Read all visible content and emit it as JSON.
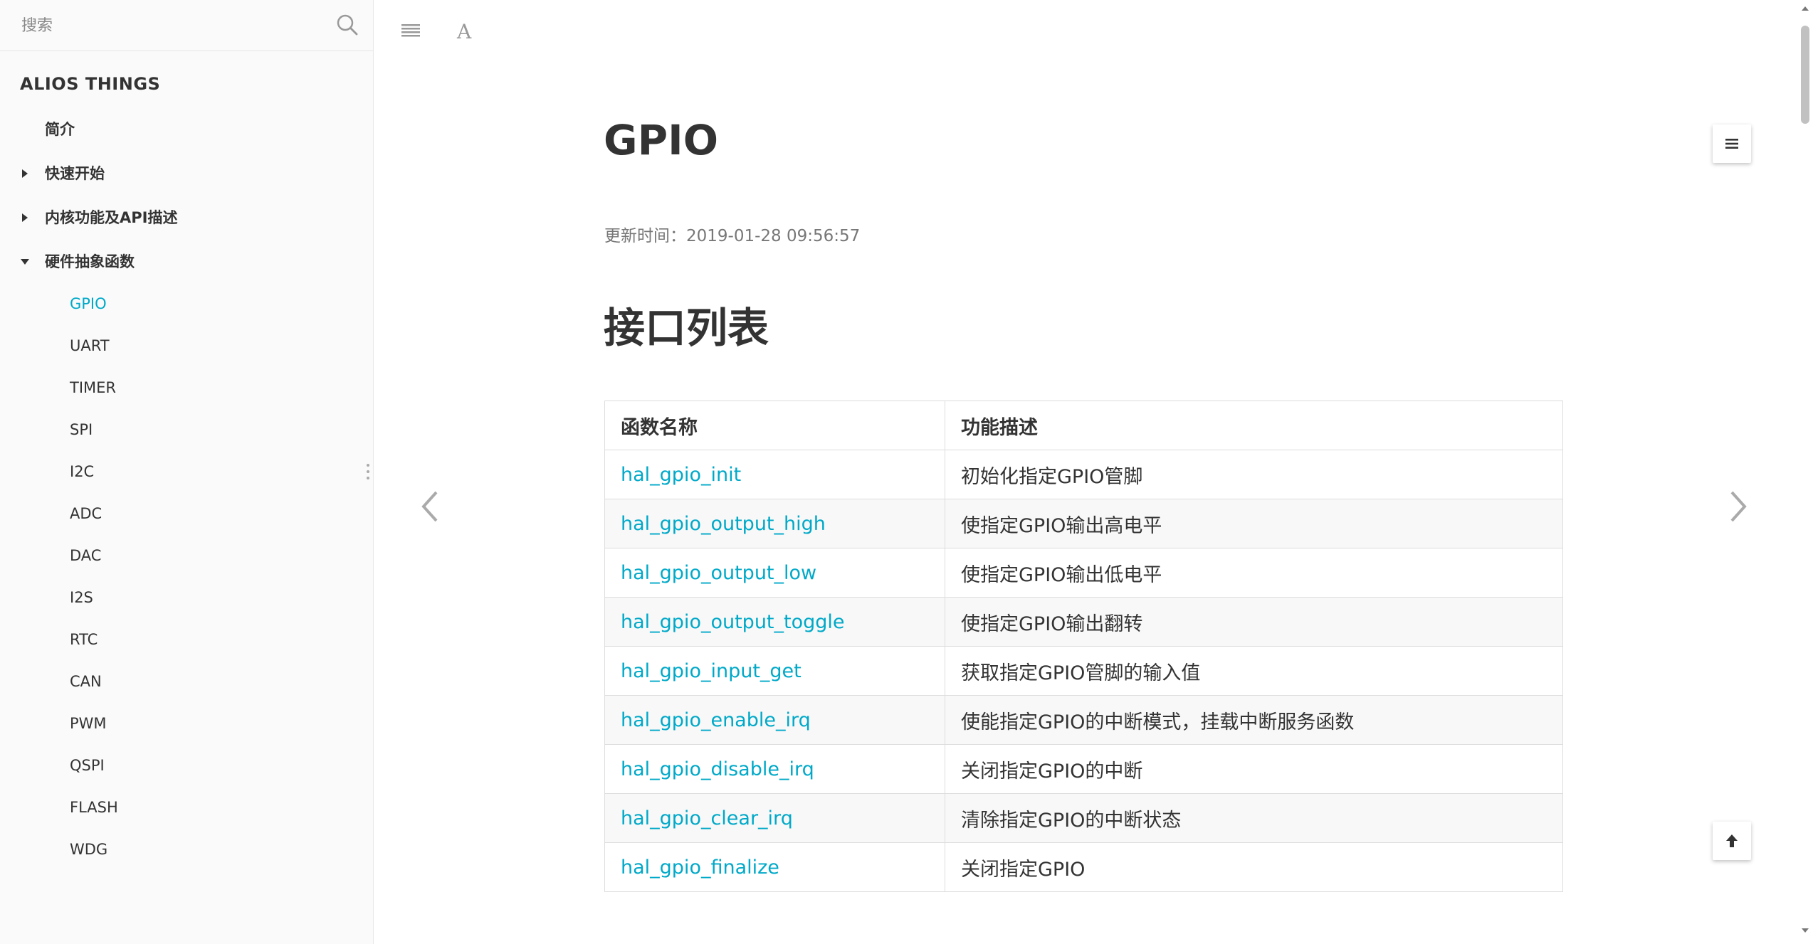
{
  "search": {
    "placeholder": "搜索"
  },
  "sidebar": {
    "brand": "ALIOS THINGS",
    "sections": [
      {
        "label": "简介",
        "caret": "none"
      },
      {
        "label": "快速开始",
        "caret": "right"
      },
      {
        "label": "内核功能及API描述",
        "caret": "right"
      },
      {
        "label": "硬件抽象函数",
        "caret": "down"
      }
    ],
    "sub_items": [
      "GPIO",
      "UART",
      "TIMER",
      "SPI",
      "I2C",
      "ADC",
      "DAC",
      "I2S",
      "RTC",
      "CAN",
      "PWM",
      "QSPI",
      "FLASH",
      "WDG"
    ],
    "active_item": "GPIO"
  },
  "main": {
    "title": "GPIO",
    "update_time": "更新时间：2019-01-28 09:56:57",
    "section_title": "接口列表",
    "table": {
      "headers": [
        "函数名称",
        "功能描述"
      ],
      "rows": [
        {
          "name": "hal_gpio_init",
          "desc": "初始化指定GPIO管脚"
        },
        {
          "name": "hal_gpio_output_high",
          "desc": "使指定GPIO输出高电平"
        },
        {
          "name": "hal_gpio_output_low",
          "desc": "使指定GPIO输出低电平"
        },
        {
          "name": "hal_gpio_output_toggle",
          "desc": "使指定GPIO输出翻转"
        },
        {
          "name": "hal_gpio_input_get",
          "desc": "获取指定GPIO管脚的输入值"
        },
        {
          "name": "hal_gpio_enable_irq",
          "desc": "使能指定GPIO的中断模式，挂载中断服务函数"
        },
        {
          "name": "hal_gpio_disable_irq",
          "desc": "关闭指定GPIO的中断"
        },
        {
          "name": "hal_gpio_clear_irq",
          "desc": "清除指定GPIO的中断状态"
        },
        {
          "name": "hal_gpio_finalize",
          "desc": "关闭指定GPIO"
        }
      ]
    }
  },
  "icons": {
    "search": "search-icon",
    "menu": "menu-icon",
    "font": "font-size-icon",
    "prev": "chevron-left-icon",
    "next": "chevron-right-icon",
    "toc": "toc-icon",
    "top": "arrow-up-icon"
  },
  "colors": {
    "accent": "#00a9c8",
    "text": "#333333",
    "muted": "#777777"
  }
}
